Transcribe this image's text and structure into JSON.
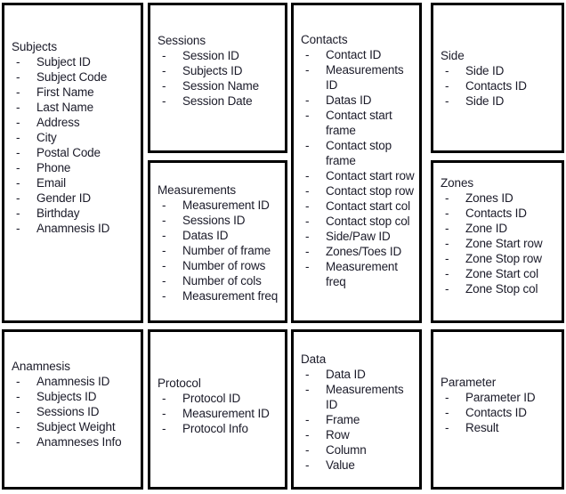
{
  "diagram": {
    "title": "Database entity attribute boxes",
    "background_color": "#ffffff",
    "border_color": "#000000",
    "text_color": "#1b1b29"
  },
  "entities": [
    {
      "id": "subjects",
      "title": "Subjects",
      "attributes": [
        "Subject ID",
        "Subject Code",
        "First Name",
        "Last Name",
        "Address",
        "City",
        "Postal Code",
        "Phone",
        "Email",
        "Gender ID",
        "Birthday",
        "Anamnesis ID"
      ]
    },
    {
      "id": "sessions",
      "title": "Sessions",
      "attributes": [
        "Session ID",
        "Subjects ID",
        "Session Name",
        "Session Date"
      ]
    },
    {
      "id": "measurements",
      "title": "Measurements",
      "attributes": [
        "Measurement ID",
        "Sessions ID",
        "Datas ID",
        "Number of frame",
        "Number of rows",
        "Number of cols",
        "Measurement freq"
      ]
    },
    {
      "id": "contacts",
      "title": "Contacts",
      "attributes": [
        "Contact ID",
        "Measurements  ID",
        "Datas ID",
        "Contact start frame",
        "Contact stop frame",
        "Contact start row",
        "Contact stop row",
        "Contact start col",
        "Contact stop col",
        "Side/Paw ID",
        "Zones/Toes ID",
        "Measurement freq"
      ]
    },
    {
      "id": "side",
      "title": "Side",
      "attributes": [
        "Side ID",
        "Contacts ID",
        "Side ID"
      ]
    },
    {
      "id": "zones",
      "title": "Zones",
      "attributes": [
        "Zones ID",
        "Contacts ID",
        "Zone ID",
        "Zone Start row",
        "Zone Stop row",
        "Zone Start col",
        "Zone Stop col"
      ]
    },
    {
      "id": "anamnesis",
      "title": "Anamnesis",
      "attributes": [
        "Anamnesis ID",
        "Subjects ID",
        "Sessions ID",
        "Subject Weight",
        "Anamneses Info"
      ]
    },
    {
      "id": "protocol",
      "title": "Protocol",
      "attributes": [
        "Protocol ID",
        "Measurement ID",
        "Protocol Info"
      ]
    },
    {
      "id": "data",
      "title": "Data",
      "attributes": [
        "Data ID",
        "Measurements ID",
        "Frame",
        "Row",
        "Column",
        "Value"
      ]
    },
    {
      "id": "parameter",
      "title": "Parameter",
      "attributes": [
        "Parameter ID",
        "Contacts ID",
        "Result"
      ]
    }
  ],
  "bullet": "-"
}
